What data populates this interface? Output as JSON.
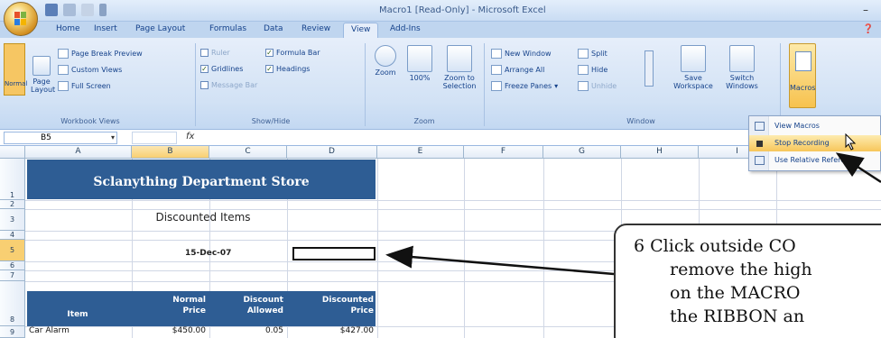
{
  "window": {
    "title": "Macro1 [Read-Only] - Microsoft Excel"
  },
  "tabs": [
    "Home",
    "Insert",
    "Page Layout",
    "Formulas",
    "Data",
    "Review",
    "View",
    "Add-Ins"
  ],
  "active_tab": "View",
  "ribbon": {
    "workbook_views": {
      "normal": "Normal",
      "page_layout": "Page Layout",
      "page_break": "Page Break Preview",
      "custom_views": "Custom Views",
      "full_screen": "Full Screen",
      "label": "Workbook Views"
    },
    "show_hide": {
      "ruler": "Ruler",
      "gridlines": "Gridlines",
      "message_bar": "Message Bar",
      "formula_bar": "Formula Bar",
      "headings": "Headings",
      "label": "Show/Hide"
    },
    "zoom": {
      "zoom": "Zoom",
      "hundred": "100%",
      "zoom_to_selection": "Zoom to Selection",
      "label": "Zoom"
    },
    "window": {
      "new_window": "New Window",
      "arrange_all": "Arrange All",
      "freeze_panes": "Freeze Panes",
      "split": "Split",
      "hide": "Hide",
      "unhide": "Unhide",
      "save_workspace": "Save Workspace",
      "switch_windows": "Switch Windows",
      "label": "Window"
    },
    "macros": {
      "label": "Macros"
    }
  },
  "macros_menu": {
    "items": [
      "View Macros",
      "Stop Recording",
      "Use Relative References"
    ]
  },
  "formula_bar": {
    "name_box": "B5",
    "fx": "fx"
  },
  "columns": [
    "A",
    "B",
    "C",
    "D",
    "E",
    "F",
    "G",
    "H",
    "I"
  ],
  "rows": [
    "1",
    "2",
    "3",
    "4",
    "5",
    "6",
    "7",
    "8",
    "9"
  ],
  "sheet": {
    "store_name": "Sclanything Department Store",
    "subtitle": "Discounted Items",
    "date": "15-Dec-07",
    "table_headers": {
      "item": "Item",
      "normal_price": [
        "Normal",
        "Price"
      ],
      "discount_allowed": [
        "Discount",
        "Allowed"
      ],
      "discounted_price": [
        "Discounted",
        "Price"
      ]
    },
    "row9": {
      "item": "Car Alarm",
      "normal_price": "$450.00",
      "discount": "0.05",
      "discounted": "$427.00"
    }
  },
  "callout": {
    "line1": "6  Click outside CO",
    "line2": "remove the high",
    "line3": "on the MACRO",
    "line4": "the RIBBON an"
  }
}
